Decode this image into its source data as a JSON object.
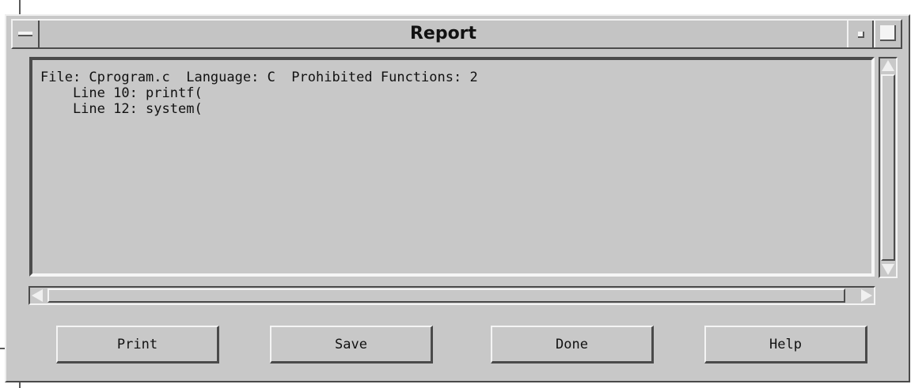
{
  "window": {
    "title": "Report"
  },
  "report": {
    "text": "File: Cprogram.c  Language: C  Prohibited Functions: 2\n    Line 10: printf(\n    Line 12: system("
  },
  "buttons": {
    "print": "Print",
    "save": "Save",
    "done": "Done",
    "help": "Help"
  },
  "icons": {
    "window_menu": "window-menu-icon",
    "minimize": "minimize-icon",
    "maximize": "maximize-icon",
    "scroll_up": "arrow-up-icon",
    "scroll_down": "arrow-down-icon",
    "scroll_left": "arrow-left-icon",
    "scroll_right": "arrow-right-icon"
  },
  "colors": {
    "background": "#c8c8c8",
    "highlight": "#f4f4f4",
    "shadow": "#4a4a4a"
  }
}
